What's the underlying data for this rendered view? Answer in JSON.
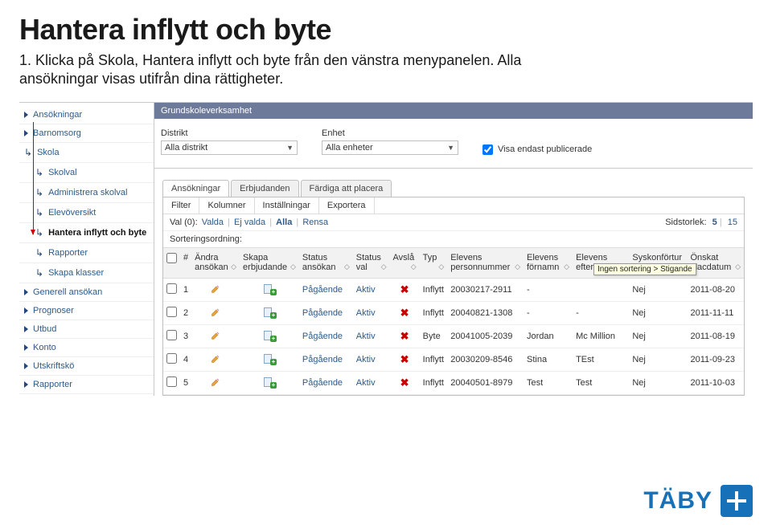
{
  "title": "Hantera inflytt och byte",
  "subtitle_line1": "1. Klicka på Skola, Hantera inflytt och byte från den vänstra menypanelen. Alla",
  "subtitle_line2": "ansökningar visas utifrån dina rättigheter.",
  "sidebar": {
    "items": [
      {
        "label": "Ansökningar",
        "icon": "arrow",
        "indent": false,
        "bold": false
      },
      {
        "label": "Barnomsorg",
        "icon": "arrow",
        "indent": false,
        "bold": false
      },
      {
        "label": "Skola",
        "icon": "curve",
        "indent": false,
        "bold": false
      },
      {
        "label": "Skolval",
        "icon": "curve",
        "indent": true,
        "bold": false
      },
      {
        "label": "Administrera skolval",
        "icon": "curve",
        "indent": true,
        "bold": false
      },
      {
        "label": "Elevöversikt",
        "icon": "curve",
        "indent": true,
        "bold": false
      },
      {
        "label": "Hantera inflytt och byte",
        "icon": "curve",
        "indent": true,
        "bold": true
      },
      {
        "label": "Rapporter",
        "icon": "curve",
        "indent": true,
        "bold": false
      },
      {
        "label": "Skapa klasser",
        "icon": "curve",
        "indent": true,
        "bold": false
      },
      {
        "label": "Generell ansökan",
        "icon": "arrow",
        "indent": false,
        "bold": false
      },
      {
        "label": "Prognoser",
        "icon": "arrow",
        "indent": false,
        "bold": false
      },
      {
        "label": "Utbud",
        "icon": "arrow",
        "indent": false,
        "bold": false
      },
      {
        "label": "Konto",
        "icon": "arrow",
        "indent": false,
        "bold": false
      },
      {
        "label": "Utskriftskö",
        "icon": "arrow",
        "indent": false,
        "bold": false
      },
      {
        "label": "Rapporter",
        "icon": "arrow",
        "indent": false,
        "bold": false
      }
    ]
  },
  "breadcrumb": "Grundskoleverksamhet",
  "filters": {
    "distrikt_label": "Distrikt",
    "distrikt_value": "Alla distrikt",
    "enhet_label": "Enhet",
    "enhet_value": "Alla enheter",
    "checkbox_label": "Visa endast publicerade",
    "checkbox_checked": true
  },
  "tabs": [
    {
      "label": "Ansökningar",
      "active": true
    },
    {
      "label": "Erbjudanden",
      "active": false
    },
    {
      "label": "Färdiga att placera",
      "active": false
    }
  ],
  "toolbar": [
    {
      "label": "Filter"
    },
    {
      "label": "Kolumner"
    },
    {
      "label": "Inställningar"
    },
    {
      "label": "Exportera"
    }
  ],
  "valrow": {
    "prefix": "Val (0):",
    "links": [
      {
        "label": "Valda",
        "bold": false
      },
      {
        "label": "Ej valda",
        "bold": false
      },
      {
        "label": "Alla",
        "bold": true
      },
      {
        "label": "Rensa",
        "bold": false
      }
    ],
    "pagesize_label": "Sidstorlek:",
    "pagesizes": [
      {
        "label": "5",
        "active": true
      },
      {
        "label": "15",
        "active": false
      }
    ]
  },
  "sortrow": "Sorteringsordning:",
  "headers": [
    {
      "label": ""
    },
    {
      "label": "#"
    },
    {
      "label": "Ändra ansökan"
    },
    {
      "label": "Skapa erbjudande"
    },
    {
      "label": "Status ansökan"
    },
    {
      "label": "Status val"
    },
    {
      "label": "Avslå"
    },
    {
      "label": "Typ"
    },
    {
      "label": "Elevens personnummer"
    },
    {
      "label": "Elevens förnamn"
    },
    {
      "label": "Elevens efternamn"
    },
    {
      "label": "Syskonförtur"
    },
    {
      "label": "Önskat placdatum"
    }
  ],
  "tooltip": "Ingen sortering > Stigande",
  "rows": [
    {
      "n": "1",
      "status_ansokan": "Pågående",
      "status_val": "Aktiv",
      "typ": "Inflytt",
      "pnr": "20030217-2911",
      "fornamn": "-",
      "efternamn": "",
      "syskon": "Nej",
      "datum": "2011-08-20"
    },
    {
      "n": "2",
      "status_ansokan": "Pågående",
      "status_val": "Aktiv",
      "typ": "Inflytt",
      "pnr": "20040821-1308",
      "fornamn": "-",
      "efternamn": "-",
      "syskon": "Nej",
      "datum": "2011-11-11"
    },
    {
      "n": "3",
      "status_ansokan": "Pågående",
      "status_val": "Aktiv",
      "typ": "Byte",
      "pnr": "20041005-2039",
      "fornamn": "Jordan",
      "efternamn": "Mc Million",
      "syskon": "Nej",
      "datum": "2011-08-19"
    },
    {
      "n": "4",
      "status_ansokan": "Pågående",
      "status_val": "Aktiv",
      "typ": "Inflytt",
      "pnr": "20030209-8546",
      "fornamn": "Stina",
      "efternamn": "TEst",
      "syskon": "Nej",
      "datum": "2011-09-23"
    },
    {
      "n": "5",
      "status_ansokan": "Pågående",
      "status_val": "Aktiv",
      "typ": "Inflytt",
      "pnr": "20040501-8979",
      "fornamn": "Test",
      "efternamn": "Test",
      "syskon": "Nej",
      "datum": "2011-10-03"
    }
  ],
  "logo_text": "TÄBY"
}
